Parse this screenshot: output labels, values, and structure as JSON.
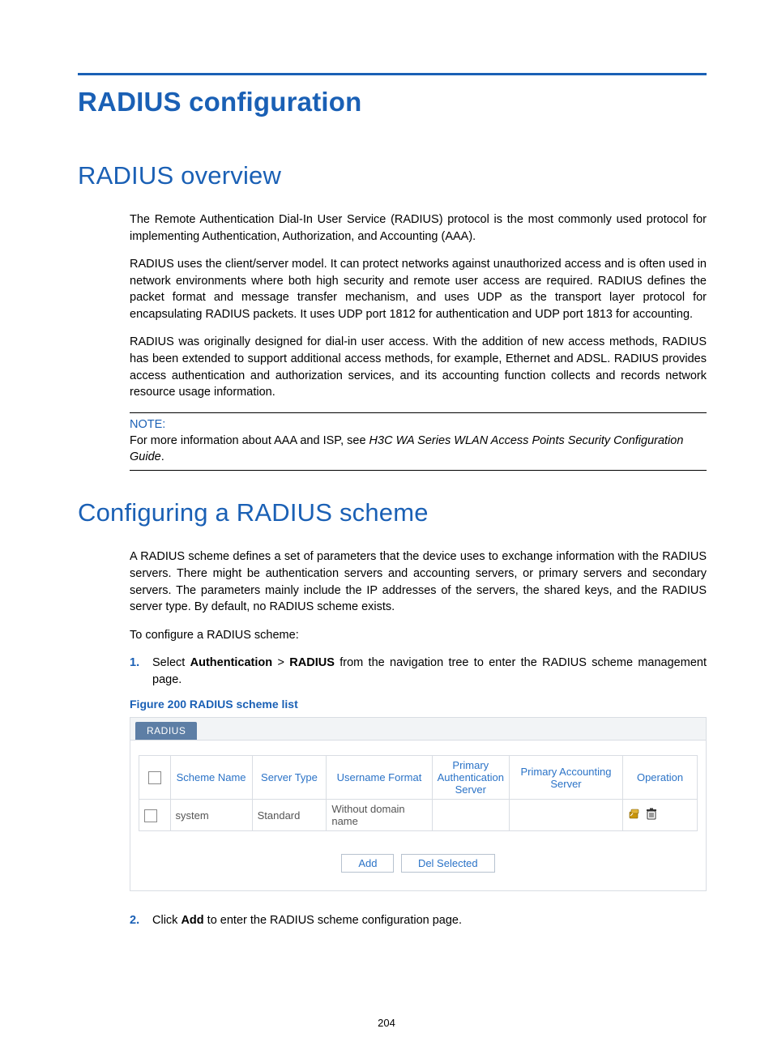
{
  "title": "RADIUS configuration",
  "overview": {
    "heading": "RADIUS overview",
    "p1": "The Remote Authentication Dial-In User Service (RADIUS) protocol is the most commonly used protocol for implementing Authentication, Authorization, and Accounting (AAA).",
    "p2": "RADIUS uses the client/server model. It can protect networks against unauthorized access and is often used in network environments where both high security and remote user access are required. RADIUS defines the packet format and message transfer mechanism, and uses UDP as the transport layer protocol for encapsulating RADIUS packets. It uses UDP port 1812 for authentication and UDP port 1813 for accounting.",
    "p3": "RADIUS was originally designed for dial-in user access. With the addition of new access methods, RADIUS has been extended to support additional access methods, for example, Ethernet and ADSL. RADIUS provides access authentication and authorization services, and its accounting function collects and records network resource usage information."
  },
  "note": {
    "label": "NOTE:",
    "text_prefix": "For more information about AAA and ISP, see ",
    "text_italic": "H3C WA Series WLAN Access Points Security Configuration Guide",
    "text_suffix": "."
  },
  "config": {
    "heading": "Configuring a RADIUS scheme",
    "p1": "A RADIUS scheme defines a set of parameters that the device uses to exchange information with the RADIUS servers. There might be authentication servers and accounting servers, or primary servers and secondary servers. The parameters mainly include the IP addresses of the servers, the shared keys, and the RADIUS server type. By default, no RADIUS scheme exists.",
    "p2": "To configure a RADIUS scheme:"
  },
  "steps": {
    "s1_num": "1.",
    "s1_a": "Select ",
    "s1_b": "Authentication",
    "s1_c": " > ",
    "s1_d": "RADIUS",
    "s1_e": " from the navigation tree to enter the RADIUS scheme management page.",
    "s2_num": "2.",
    "s2_a": "Click ",
    "s2_b": "Add",
    "s2_c": " to enter the RADIUS scheme configuration page."
  },
  "figure": {
    "caption": "Figure 200 RADIUS scheme list",
    "tab_label": "RADIUS",
    "headers": {
      "scheme": "Scheme Name",
      "server_type": "Server Type",
      "username_format": "Username Format",
      "primary_auth": "Primary Authentication Server",
      "primary_acct": "Primary Accounting Server",
      "operation": "Operation"
    },
    "row": {
      "scheme": "system",
      "server_type": "Standard",
      "username_format": "Without domain name",
      "primary_auth": "",
      "primary_acct": ""
    },
    "buttons": {
      "add": "Add",
      "del": "Del Selected"
    }
  },
  "page_number": "204"
}
